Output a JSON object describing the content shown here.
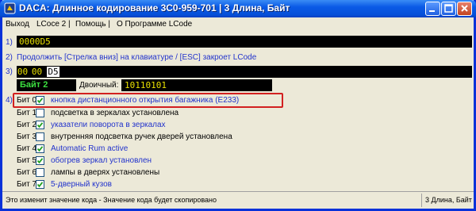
{
  "window": {
    "title": "DACA: Длинное кодирование   3C0-959-701  |  3 Длина, Байт"
  },
  "menu": [
    "Выход",
    "LCoce 2 |",
    "Помощь |",
    "О Программе LCode"
  ],
  "step1": {
    "num": "1)",
    "value": "0000D5"
  },
  "step2": {
    "num": "2)",
    "hint": "Продолжить [Стрелка вниз] на клавиатуре / [ESC] закроет LCode"
  },
  "step3": {
    "num": "3)",
    "bytes": [
      "00",
      "00",
      "D5"
    ]
  },
  "byte_panel": {
    "label": "Байт 2",
    "binary_label": "Двоичный:",
    "binary_value": "10110101"
  },
  "step4": {
    "num": "4)"
  },
  "bits": [
    {
      "label": "Бит 0",
      "checked": true,
      "text": "кнопка дистанционного открытия багажника (E233)"
    },
    {
      "label": "Бит 1",
      "checked": false,
      "text": "подсветка в зеркалах установлена"
    },
    {
      "label": "Бит 2",
      "checked": true,
      "text": "указатели поворота в зеркалах"
    },
    {
      "label": "Бит 3",
      "checked": false,
      "text": "внутренняя подсветка ручек дверей установлена"
    },
    {
      "label": "Бит 4",
      "checked": true,
      "text": "Automatic Rum active"
    },
    {
      "label": "Бит 5",
      "checked": true,
      "text": "обогрев зеркал установлен"
    },
    {
      "label": "Бит 6",
      "checked": false,
      "text": "лампы в дверях установлены"
    },
    {
      "label": "Бит 7",
      "checked": true,
      "text": "5-дверный кузов"
    }
  ],
  "status": {
    "left": "Это изменит значение кода - Значение кода будет скопировано",
    "right": "3 Длина, Байт"
  },
  "colors": {
    "checked_text": "#2233CC",
    "unchecked_text": "#000000",
    "highlight": "#D22020",
    "value_text": "#E8E000",
    "byte_label": "#3CE040"
  }
}
